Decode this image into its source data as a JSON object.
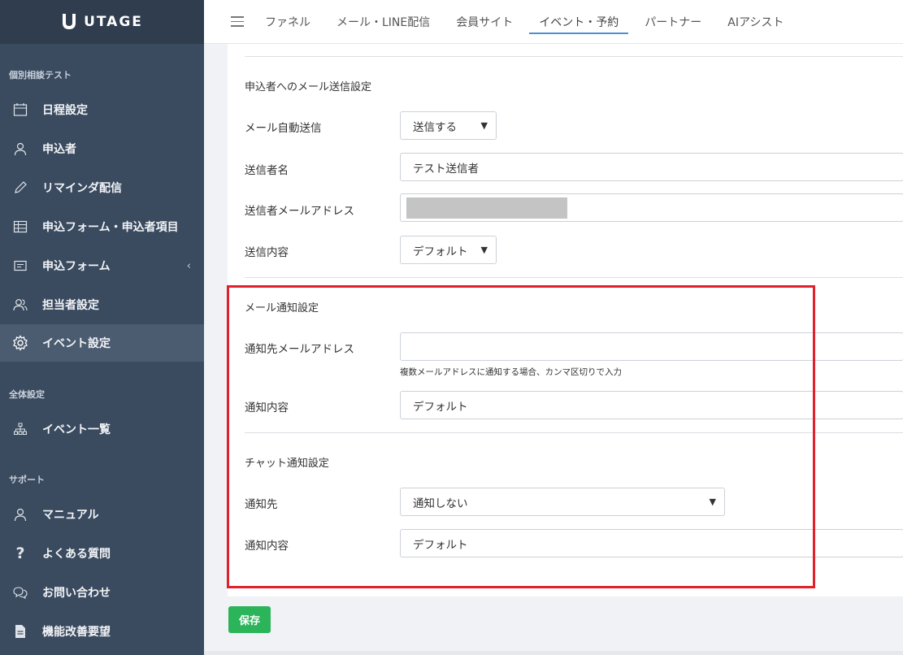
{
  "brand": {
    "name": "UTAGE"
  },
  "sidebar": {
    "section_event": "個別相談テスト",
    "section_global": "全体設定",
    "section_support": "サポート",
    "items": [
      {
        "label": "日程設定",
        "icon": "calendar-icon"
      },
      {
        "label": "申込者",
        "icon": "user-icon"
      },
      {
        "label": "リマインダ配信",
        "icon": "pencil-icon"
      },
      {
        "label": "申込フォーム・申込者項目",
        "icon": "table-icon"
      },
      {
        "label": "申込フォーム",
        "icon": "form-icon"
      },
      {
        "label": "担当者設定",
        "icon": "users-icon"
      },
      {
        "label": "イベント設定",
        "icon": "gear-icon"
      },
      {
        "label": "イベント一覧",
        "icon": "sitemap-icon"
      },
      {
        "label": "マニュアル",
        "icon": "user-icon"
      },
      {
        "label": "よくある質問",
        "icon": "question-icon"
      },
      {
        "label": "お問い合わせ",
        "icon": "chat-icon"
      },
      {
        "label": "機能改善要望",
        "icon": "document-icon"
      }
    ]
  },
  "topnav": {
    "tabs": [
      "ファネル",
      "メール・LINE配信",
      "会員サイト",
      "イベント・予約",
      "パートナー",
      "AIアシスト"
    ],
    "active": "イベント・予約"
  },
  "applicant_mail": {
    "title": "申込者へのメール送信設定",
    "auto_send_label": "メール自動送信",
    "auto_send_value": "送信する",
    "sender_name_label": "送信者名",
    "sender_name_value": "テスト送信者",
    "sender_email_label": "送信者メールアドレス",
    "content_label": "送信内容",
    "content_value": "デフォルト"
  },
  "mail_notify": {
    "title": "メール通知設定",
    "email_label": "通知先メールアドレス",
    "email_value": "",
    "email_help": "複数メールアドレスに通知する場合、カンマ区切りで入力",
    "content_label": "通知内容",
    "content_value": "デフォルト"
  },
  "chat_notify": {
    "title": "チャット通知設定",
    "target_label": "通知先",
    "target_value": "通知しない",
    "content_label": "通知内容",
    "content_value": "デフォルト"
  },
  "actions": {
    "save_label": "保存"
  },
  "colors": {
    "sidebar": "#3a4a5f",
    "highlight": "#e0202a",
    "save": "#2cb45a",
    "tab_underline": "#4a8fd6"
  }
}
